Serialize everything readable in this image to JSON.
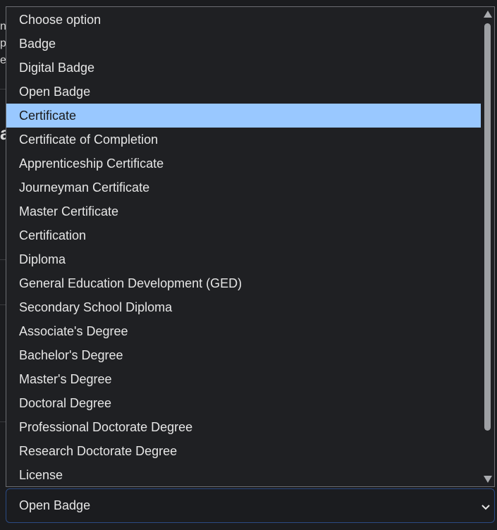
{
  "background_fragments": [
    "ne",
    "pa",
    "ea",
    "a"
  ],
  "dropdown": {
    "options": [
      {
        "label": "Choose option",
        "selected": false
      },
      {
        "label": "Badge",
        "selected": false
      },
      {
        "label": "Digital Badge",
        "selected": false
      },
      {
        "label": "Open Badge",
        "selected": false
      },
      {
        "label": "Certificate",
        "selected": true
      },
      {
        "label": "Certificate of Completion",
        "selected": false
      },
      {
        "label": "Apprenticeship Certificate",
        "selected": false
      },
      {
        "label": "Journeyman Certificate",
        "selected": false
      },
      {
        "label": "Master Certificate",
        "selected": false
      },
      {
        "label": "Certification",
        "selected": false
      },
      {
        "label": "Diploma",
        "selected": false
      },
      {
        "label": "General Education Development (GED)",
        "selected": false
      },
      {
        "label": "Secondary School Diploma",
        "selected": false
      },
      {
        "label": "Associate's Degree",
        "selected": false
      },
      {
        "label": "Bachelor's Degree",
        "selected": false
      },
      {
        "label": "Master's Degree",
        "selected": false
      },
      {
        "label": "Doctoral Degree",
        "selected": false
      },
      {
        "label": "Professional Doctorate Degree",
        "selected": false
      },
      {
        "label": "Research Doctorate Degree",
        "selected": false
      },
      {
        "label": "License",
        "selected": false
      }
    ],
    "highlight_color": "#99c8ff"
  },
  "select": {
    "value": "Open Badge"
  },
  "icons": {
    "scroll_up": "triangle-up-icon",
    "scroll_down": "triangle-down-icon",
    "dropdown_chevron": "chevron-down-icon"
  }
}
